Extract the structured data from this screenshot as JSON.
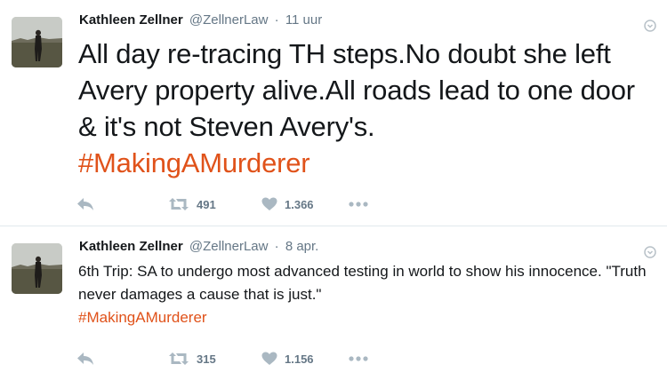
{
  "tweets": [
    {
      "author_name": "Kathleen Zellner",
      "author_handle": "@ZellnerLaw",
      "separator": "·",
      "timestamp": "11 uur",
      "text": "All day re-tracing TH steps.No doubt she left Avery property alive.All roads lead to one door & it's not Steven Avery's.",
      "hashtag": "#MakingAMurderer",
      "retweet_count": "491",
      "like_count": "1.366"
    },
    {
      "author_name": "Kathleen Zellner",
      "author_handle": "@ZellnerLaw",
      "separator": "·",
      "timestamp": "8 apr.",
      "text": "6th Trip: SA to undergo most advanced testing in world to show his innocence. \"Truth never damages a cause that is just.\"",
      "hashtag": "#MakingAMurderer",
      "retweet_count": "315",
      "like_count": "1.156"
    }
  ],
  "icons": {
    "reply": "reply-icon",
    "retweet": "retweet-icon",
    "like": "heart-icon",
    "more": "more-dots-icon",
    "caret": "chevron-down-icon"
  },
  "colors": {
    "hashtag": "#e0521a",
    "meta_text": "#657786",
    "action_icon": "#aab8c2",
    "separator": "#e1e8ed"
  }
}
